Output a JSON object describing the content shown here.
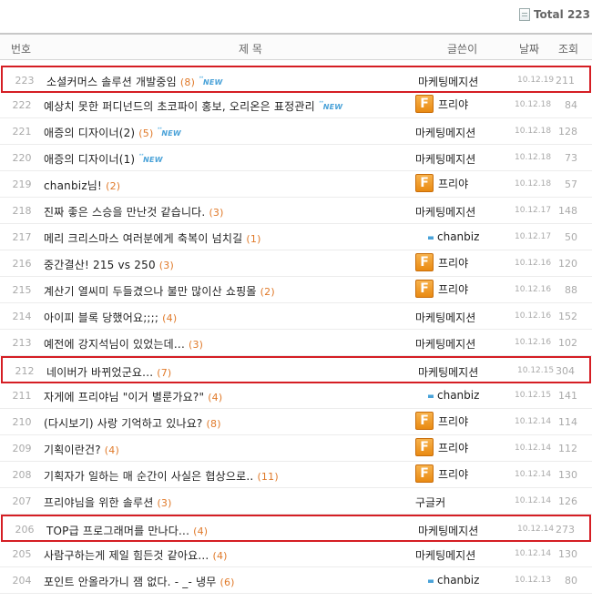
{
  "total": {
    "label": "Total",
    "count": "223"
  },
  "header": {
    "num": "번호",
    "title": "제 목",
    "author": "글쓴이",
    "date": "날짜",
    "views": "조회"
  },
  "posts": [
    {
      "num": "223",
      "title": "소셜커머스 솔루션 개발중임",
      "comments": "(8)",
      "is_new": true,
      "author": "마케팅메지션",
      "author_icon": false,
      "date": "10.12.19",
      "views": "211",
      "highlighted": true
    },
    {
      "num": "222",
      "title": "예상치 못한 퍼디넌드의 초코파이 홍보, 오리온은 표정관리",
      "comments": "",
      "is_new": true,
      "author": "프리야",
      "author_icon": true,
      "date": "10.12.18",
      "views": "84",
      "highlighted": false
    },
    {
      "num": "221",
      "title": "애증의 디자이너(2)",
      "comments": "(5)",
      "is_new": true,
      "author": "마케팅메지션",
      "author_icon": false,
      "date": "10.12.18",
      "views": "128",
      "highlighted": false
    },
    {
      "num": "220",
      "title": "애증의 디자이너(1)",
      "comments": "",
      "is_new": true,
      "author": "마케팅메지션",
      "author_icon": false,
      "date": "10.12.18",
      "views": "73",
      "highlighted": false
    },
    {
      "num": "219",
      "title": "chanbiz님!",
      "comments": "(2)",
      "is_new": false,
      "author": "프리야",
      "author_icon": true,
      "date": "10.12.18",
      "views": "57",
      "highlighted": false
    },
    {
      "num": "218",
      "title": "진짜 좋은 스승을 만난것 같습니다.",
      "comments": "(3)",
      "is_new": false,
      "author": "마케팅메지션",
      "author_icon": false,
      "date": "10.12.17",
      "views": "148",
      "highlighted": false
    },
    {
      "num": "217",
      "title": "메리 크리스마스 여러분에게 축복이 넘치길",
      "comments": "(1)",
      "is_new": false,
      "author": "chanbiz",
      "author_icon": false,
      "author_bar": true,
      "date": "10.12.17",
      "views": "50",
      "highlighted": false
    },
    {
      "num": "216",
      "title": "중간결산! 215 vs 250",
      "comments": "(3)",
      "is_new": false,
      "author": "프리야",
      "author_icon": true,
      "date": "10.12.16",
      "views": "120",
      "highlighted": false
    },
    {
      "num": "215",
      "title": "계산기 열씨미 두들겼으나 불만 많이산 쇼핑몰",
      "comments": "(2)",
      "is_new": false,
      "author": "프리야",
      "author_icon": true,
      "date": "10.12.16",
      "views": "88",
      "highlighted": false
    },
    {
      "num": "214",
      "title": "아이피 블록 당했어요;;;;",
      "comments": "(4)",
      "is_new": false,
      "author": "마케팅메지션",
      "author_icon": false,
      "date": "10.12.16",
      "views": "152",
      "highlighted": false
    },
    {
      "num": "213",
      "title": "예전에 강지석님이 있었는데...",
      "comments": "(3)",
      "is_new": false,
      "author": "마케팅메지션",
      "author_icon": false,
      "date": "10.12.16",
      "views": "102",
      "highlighted": false
    },
    {
      "num": "212",
      "title": "네이버가 바뀌었군요...",
      "comments": "(7)",
      "is_new": false,
      "author": "마케팅메지션",
      "author_icon": false,
      "date": "10.12.15",
      "views": "304",
      "highlighted": true
    },
    {
      "num": "211",
      "title": "자게에 프리야님 \"이거 별룬가요?\"",
      "comments": "(4)",
      "is_new": false,
      "author": "chanbiz",
      "author_icon": false,
      "author_bar": true,
      "date": "10.12.15",
      "views": "141",
      "highlighted": false
    },
    {
      "num": "210",
      "title": "(다시보기) 사랑 기억하고 있나요?",
      "comments": "(8)",
      "is_new": false,
      "author": "프리야",
      "author_icon": true,
      "date": "10.12.14",
      "views": "114",
      "highlighted": false
    },
    {
      "num": "209",
      "title": "기획이란건?",
      "comments": "(4)",
      "is_new": false,
      "author": "프리야",
      "author_icon": true,
      "date": "10.12.14",
      "views": "112",
      "highlighted": false
    },
    {
      "num": "208",
      "title": "기획자가 일하는 매 순간이 사실은 협상으로..",
      "comments": "(11)",
      "is_new": false,
      "author": "프리야",
      "author_icon": true,
      "date": "10.12.14",
      "views": "130",
      "highlighted": false
    },
    {
      "num": "207",
      "title": "프리야님을 위한 솔루션",
      "comments": "(3)",
      "is_new": false,
      "author": "구글커",
      "author_icon": false,
      "date": "10.12.14",
      "views": "126",
      "highlighted": false
    },
    {
      "num": "206",
      "title": "TOP급 프로그래머를 만나다...",
      "comments": "(4)",
      "is_new": false,
      "author": "마케팅메지션",
      "author_icon": false,
      "date": "10.12.14",
      "views": "273",
      "highlighted": true
    },
    {
      "num": "205",
      "title": "사람구하는게 제일 힘든것 같아요...",
      "comments": "(4)",
      "is_new": false,
      "author": "마케팅메지션",
      "author_icon": false,
      "date": "10.12.14",
      "views": "130",
      "highlighted": false
    },
    {
      "num": "204",
      "title": "포인트 안올라가니 잼 없다. - _- 냉무",
      "comments": "(6)",
      "is_new": false,
      "author": "chanbiz",
      "author_icon": false,
      "author_bar": true,
      "date": "10.12.13",
      "views": "80",
      "highlighted": false
    }
  ],
  "new_badge": "NEW",
  "author_icon_letter": "F"
}
